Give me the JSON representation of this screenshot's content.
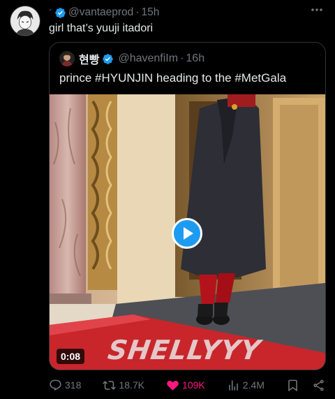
{
  "tweet": {
    "author_handle": "@vantaeprod",
    "separator": "·",
    "time": "15h",
    "text": "girl that’s yuuji itadori"
  },
  "quote": {
    "name": "현빵",
    "handle": "@havenfiIm",
    "separator": "·",
    "time": "16h",
    "text": "prince #HYUNJIN heading to the #MetGala",
    "video_duration": "0:08",
    "video_watermark": "SHELLYYY"
  },
  "actions": {
    "replies": "318",
    "reposts": "18.7K",
    "likes": "109K",
    "views": "2.4M"
  },
  "colors": {
    "background": "#000000",
    "text": "#e7e9ea",
    "secondary": "#71767b",
    "verified": "#1d9bf0",
    "like": "#f91880"
  }
}
